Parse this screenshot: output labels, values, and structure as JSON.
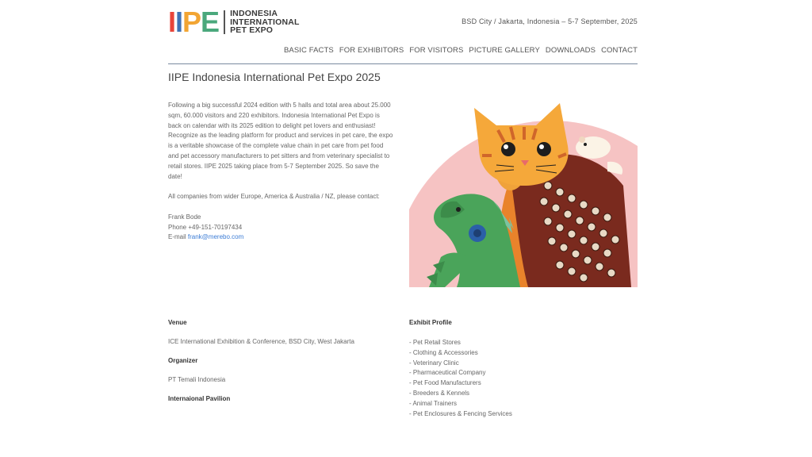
{
  "header": {
    "logo_letters": [
      {
        "char": "I",
        "color": "#e8443a"
      },
      {
        "char": "I",
        "color": "#3f72b5"
      },
      {
        "char": "P",
        "color": "#f2a533"
      },
      {
        "char": "E",
        "color": "#4aa87c"
      }
    ],
    "logo_lines": [
      "INDONESIA",
      "INTERNATIONAL",
      "PET EXPO"
    ],
    "event_line": "BSD City / Jakarta, Indonesia – 5-7 September, 2025"
  },
  "nav": [
    {
      "label": "BASIC FACTS"
    },
    {
      "label": "FOR EXHIBITORS"
    },
    {
      "label": "FOR VISITORS"
    },
    {
      "label": "PICTURE GALLERY"
    },
    {
      "label": "DOWNLOADS"
    },
    {
      "label": "CONTACT"
    }
  ],
  "main": {
    "title": "IIPE Indonesia International Pet Expo 2025",
    "intro": "Following a big successful 2024 edition with 5 halls and total area about 25.000 sqm, 60.000 visitors and 220 exhibitors. Indonesia International Pet Expo is back on calendar with its 2025 edition to delight pet lovers and enthusiast! Recognize as the leading platform for product and services in pet care, the expo is a veritable showcase of the complete value chain in pet care from pet food and pet accessory manufacturers to pet sitters and from veterinary specialist to retail stores. IIPE 2025 taking place from 5-7 September 2025. So save the date!",
    "contact_intro": "All companies from wider Europe, America & Australia / NZ, please contact:",
    "contact_name": "Frank Bode",
    "contact_phone": "Phone +49-151-70197434",
    "contact_email_label": "E-mail ",
    "contact_email": "frank@merebo.com"
  },
  "info": {
    "venue_heading": "Venue",
    "venue": "ICE International Exhibition & Conference, BSD City, West Jakarta",
    "organizer_heading": "Organizer",
    "organizer": "PT Temali Indonesia",
    "pavilion_heading": "Internaional Pavilion",
    "profile_heading": "Exhibit Profile",
    "profile_items": [
      "- Pet Retail Stores",
      "- Clothing & Accessories",
      "- Veterinary Clinic",
      "- Pharmaceutical Company",
      "- Pet Food Manufacturers",
      "- Breeders & Kennels",
      "- Animal Trainers",
      "- Pet Enclosures & Fencing Services"
    ]
  }
}
